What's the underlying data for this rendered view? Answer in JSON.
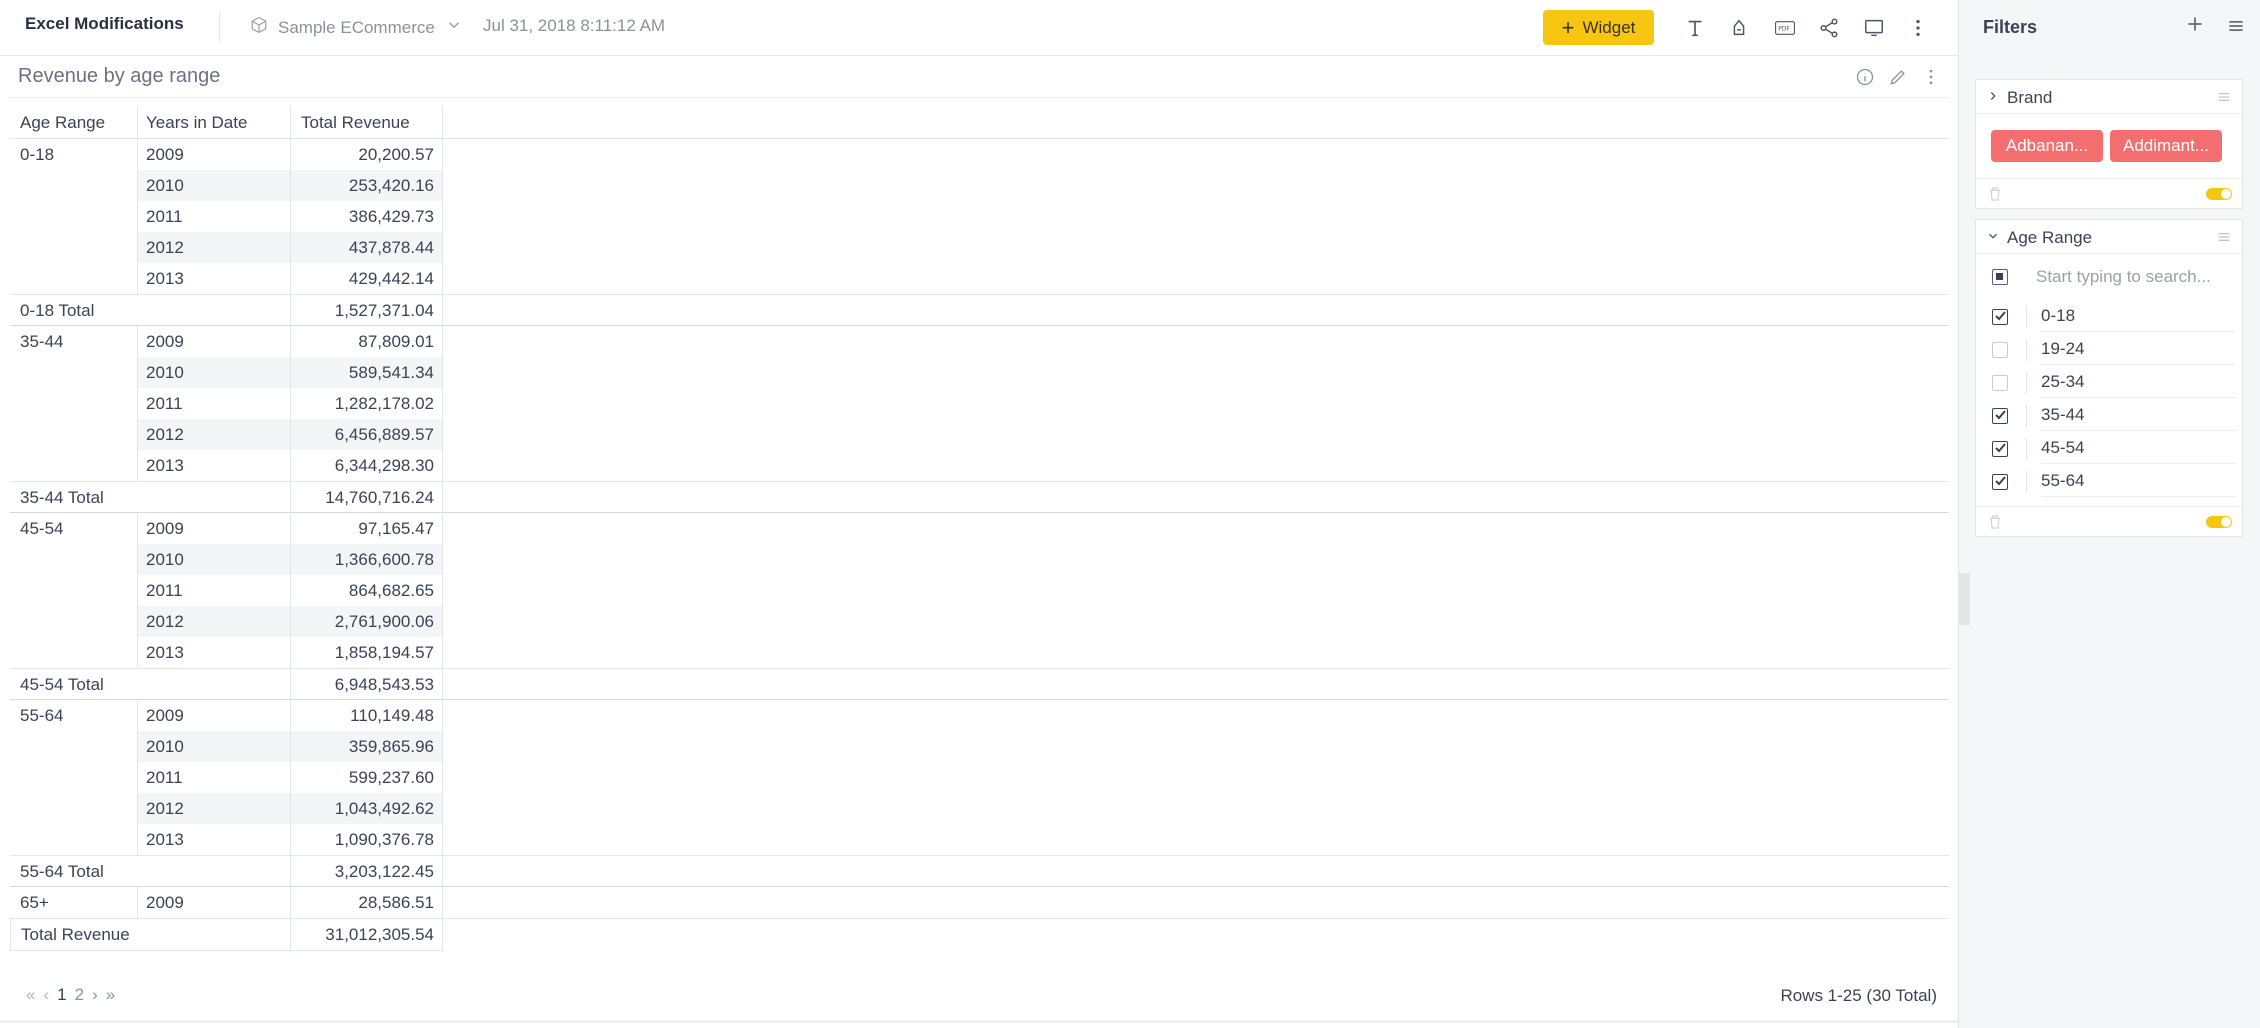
{
  "topbar": {
    "title": "Excel Modifications",
    "datasource": "Sample ECommerce",
    "timestamp": "Jul 31, 2018 8:11:12 AM",
    "widget_button": "Widget",
    "icons": [
      "text-icon",
      "paint-bucket-icon",
      "pdf-icon",
      "share-icon",
      "monitor-icon",
      "more-vertical-icon"
    ]
  },
  "widget": {
    "title": "Revenue by age range",
    "icons": [
      "info-icon",
      "edit-pencil-icon",
      "more-vertical-icon"
    ]
  },
  "pivot": {
    "headers": [
      "Age Range",
      "Years in Date",
      "Total Revenue"
    ],
    "groups": [
      {
        "age": "0-18",
        "rows": [
          [
            "2009",
            "20,200.57"
          ],
          [
            "2010",
            "253,420.16"
          ],
          [
            "2011",
            "386,429.73"
          ],
          [
            "2012",
            "437,878.44"
          ],
          [
            "2013",
            "429,442.14"
          ]
        ],
        "total_label": "0-18 Total",
        "total": "1,527,371.04"
      },
      {
        "age": "35-44",
        "rows": [
          [
            "2009",
            "87,809.01"
          ],
          [
            "2010",
            "589,541.34"
          ],
          [
            "2011",
            "1,282,178.02"
          ],
          [
            "2012",
            "6,456,889.57"
          ],
          [
            "2013",
            "6,344,298.30"
          ]
        ],
        "total_label": "35-44 Total",
        "total": "14,760,716.24"
      },
      {
        "age": "45-54",
        "rows": [
          [
            "2009",
            "97,165.47"
          ],
          [
            "2010",
            "1,366,600.78"
          ],
          [
            "2011",
            "864,682.65"
          ],
          [
            "2012",
            "2,761,900.06"
          ],
          [
            "2013",
            "1,858,194.57"
          ]
        ],
        "total_label": "45-54 Total",
        "total": "6,948,543.53"
      },
      {
        "age": "55-64",
        "rows": [
          [
            "2009",
            "110,149.48"
          ],
          [
            "2010",
            "359,865.96"
          ],
          [
            "2011",
            "599,237.60"
          ],
          [
            "2012",
            "1,043,492.62"
          ],
          [
            "2013",
            "1,090,376.78"
          ]
        ],
        "total_label": "55-64 Total",
        "total": "3,203,122.45"
      },
      {
        "age": "65+",
        "rows": [
          [
            "2009",
            "28,586.51"
          ]
        ],
        "total_label": null,
        "total": null
      }
    ],
    "grand_total_label": "Total Revenue",
    "grand_total": "31,012,305.54"
  },
  "pager": {
    "pages": [
      "1",
      "2"
    ],
    "current": "1",
    "first_icon": "«",
    "prev_icon": "‹",
    "next_icon": "›",
    "last_icon": "»",
    "rows_info": "Rows 1-25 (30 Total)"
  },
  "filters": {
    "title": "Filters",
    "brand": {
      "title": "Brand",
      "tags": [
        "Adbanan...",
        "Addimant..."
      ]
    },
    "age_range": {
      "title": "Age Range",
      "search_placeholder": "Start typing to search...",
      "options": [
        {
          "label": "0-18",
          "checked": true
        },
        {
          "label": "19-24",
          "checked": false
        },
        {
          "label": "25-34",
          "checked": false
        },
        {
          "label": "35-44",
          "checked": true
        },
        {
          "label": "45-54",
          "checked": true
        },
        {
          "label": "55-64",
          "checked": true
        }
      ]
    }
  },
  "colors": {
    "accent": "#f7c611",
    "tag": "#f36f6f",
    "text": "#3a4356",
    "muted": "#8b919c"
  }
}
